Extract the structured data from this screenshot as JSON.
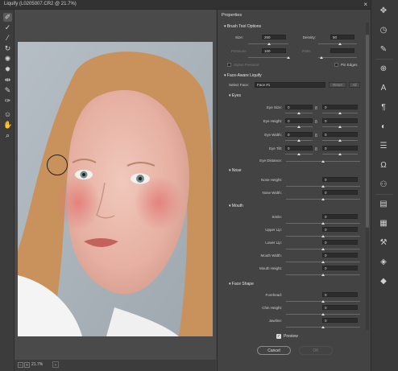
{
  "window": {
    "title": "Liquify (L0205007.CR2 @ 21.7%)",
    "close": "×"
  },
  "toolbar": {
    "tools": [
      {
        "name": "forward-warp-tool-icon",
        "glyph": "✐",
        "active": true
      },
      {
        "name": "reconstruct-tool-icon",
        "glyph": "✓"
      },
      {
        "name": "smooth-tool-icon",
        "glyph": "⁄"
      },
      {
        "name": "twirl-clockwise-tool-icon",
        "glyph": "↻"
      },
      {
        "name": "pucker-tool-icon",
        "glyph": "✺"
      },
      {
        "name": "bloat-tool-icon",
        "glyph": "✹"
      },
      {
        "name": "push-left-tool-icon",
        "glyph": "⇹"
      },
      {
        "name": "freeze-mask-tool-icon",
        "glyph": "✎"
      },
      {
        "name": "thaw-mask-tool-icon",
        "glyph": "✑"
      },
      {
        "name": "face-tool-icon",
        "glyph": "☺"
      },
      {
        "name": "hand-tool-icon",
        "glyph": "✋"
      },
      {
        "name": "zoom-tool-icon",
        "glyph": "⌕"
      }
    ]
  },
  "status": {
    "zoom": "21.7%",
    "minus": "−",
    "plus": "+",
    "dropdown": "⌄"
  },
  "panel": {
    "title": "Properties",
    "brush": {
      "header": "Brush Tool Options",
      "size_label": "Size:",
      "size_value": "250",
      "density_label": "Density:",
      "density_value": "50",
      "pressure_label": "Pressure:",
      "pressure_value": "100",
      "rate_label": "Rate:",
      "rate_value": "",
      "stylus_label": "Stylus Pressure",
      "pin_label": "Pin Edges"
    },
    "face": {
      "header": "Face-Aware Liquify",
      "select_label": "Select Face:",
      "select_value": "Face #1",
      "reset": "Reset",
      "all": "All",
      "eyes": {
        "header": "Eyes",
        "link_icon": "8",
        "rows": [
          {
            "label": "Eye Size:",
            "left": "0",
            "right": "0"
          },
          {
            "label": "Eye Height:",
            "left": "0",
            "right": "0"
          },
          {
            "label": "Eye Width:",
            "left": "0",
            "right": "0"
          },
          {
            "label": "Eye Tilt:",
            "left": "0",
            "right": "0"
          }
        ],
        "distance_label": "Eye Distance:",
        "distance_value": "0"
      },
      "nose": {
        "header": "Nose",
        "rows": [
          {
            "label": "Nose Height:",
            "value": "0"
          },
          {
            "label": "Nose Width:",
            "value": "0"
          }
        ]
      },
      "mouth": {
        "header": "Mouth",
        "rows": [
          {
            "label": "Smile:",
            "value": "0"
          },
          {
            "label": "Upper Lip:",
            "value": "0"
          },
          {
            "label": "Lower Lip:",
            "value": "0"
          },
          {
            "label": "Mouth Width:",
            "value": "0"
          },
          {
            "label": "Mouth Height:",
            "value": "0"
          }
        ]
      },
      "shape": {
        "header": "Face Shape",
        "rows": [
          {
            "label": "Forehead:",
            "value": "0"
          },
          {
            "label": "Chin Height:",
            "value": "0"
          },
          {
            "label": "Jawline:",
            "value": "0"
          }
        ]
      }
    },
    "preview_label": "Preview",
    "preview_check": "✓",
    "cancel": "Cancel",
    "ok": "OK"
  },
  "rightbar": {
    "icons": [
      "move-icon",
      "history-icon",
      "brush-icon",
      "clone-source-icon",
      "character-icon",
      "paragraph-icon",
      "adjust-icon",
      "properties-icon",
      "glyphs-icon",
      "people-icon",
      "notes-icon",
      "layers-icon",
      "tools-icon",
      "styles-icon",
      "swatches-icon"
    ]
  },
  "colors": {
    "panel_bg": "#434343",
    "field_bg": "#2c2c2c",
    "accent": "#e0e0e0"
  }
}
